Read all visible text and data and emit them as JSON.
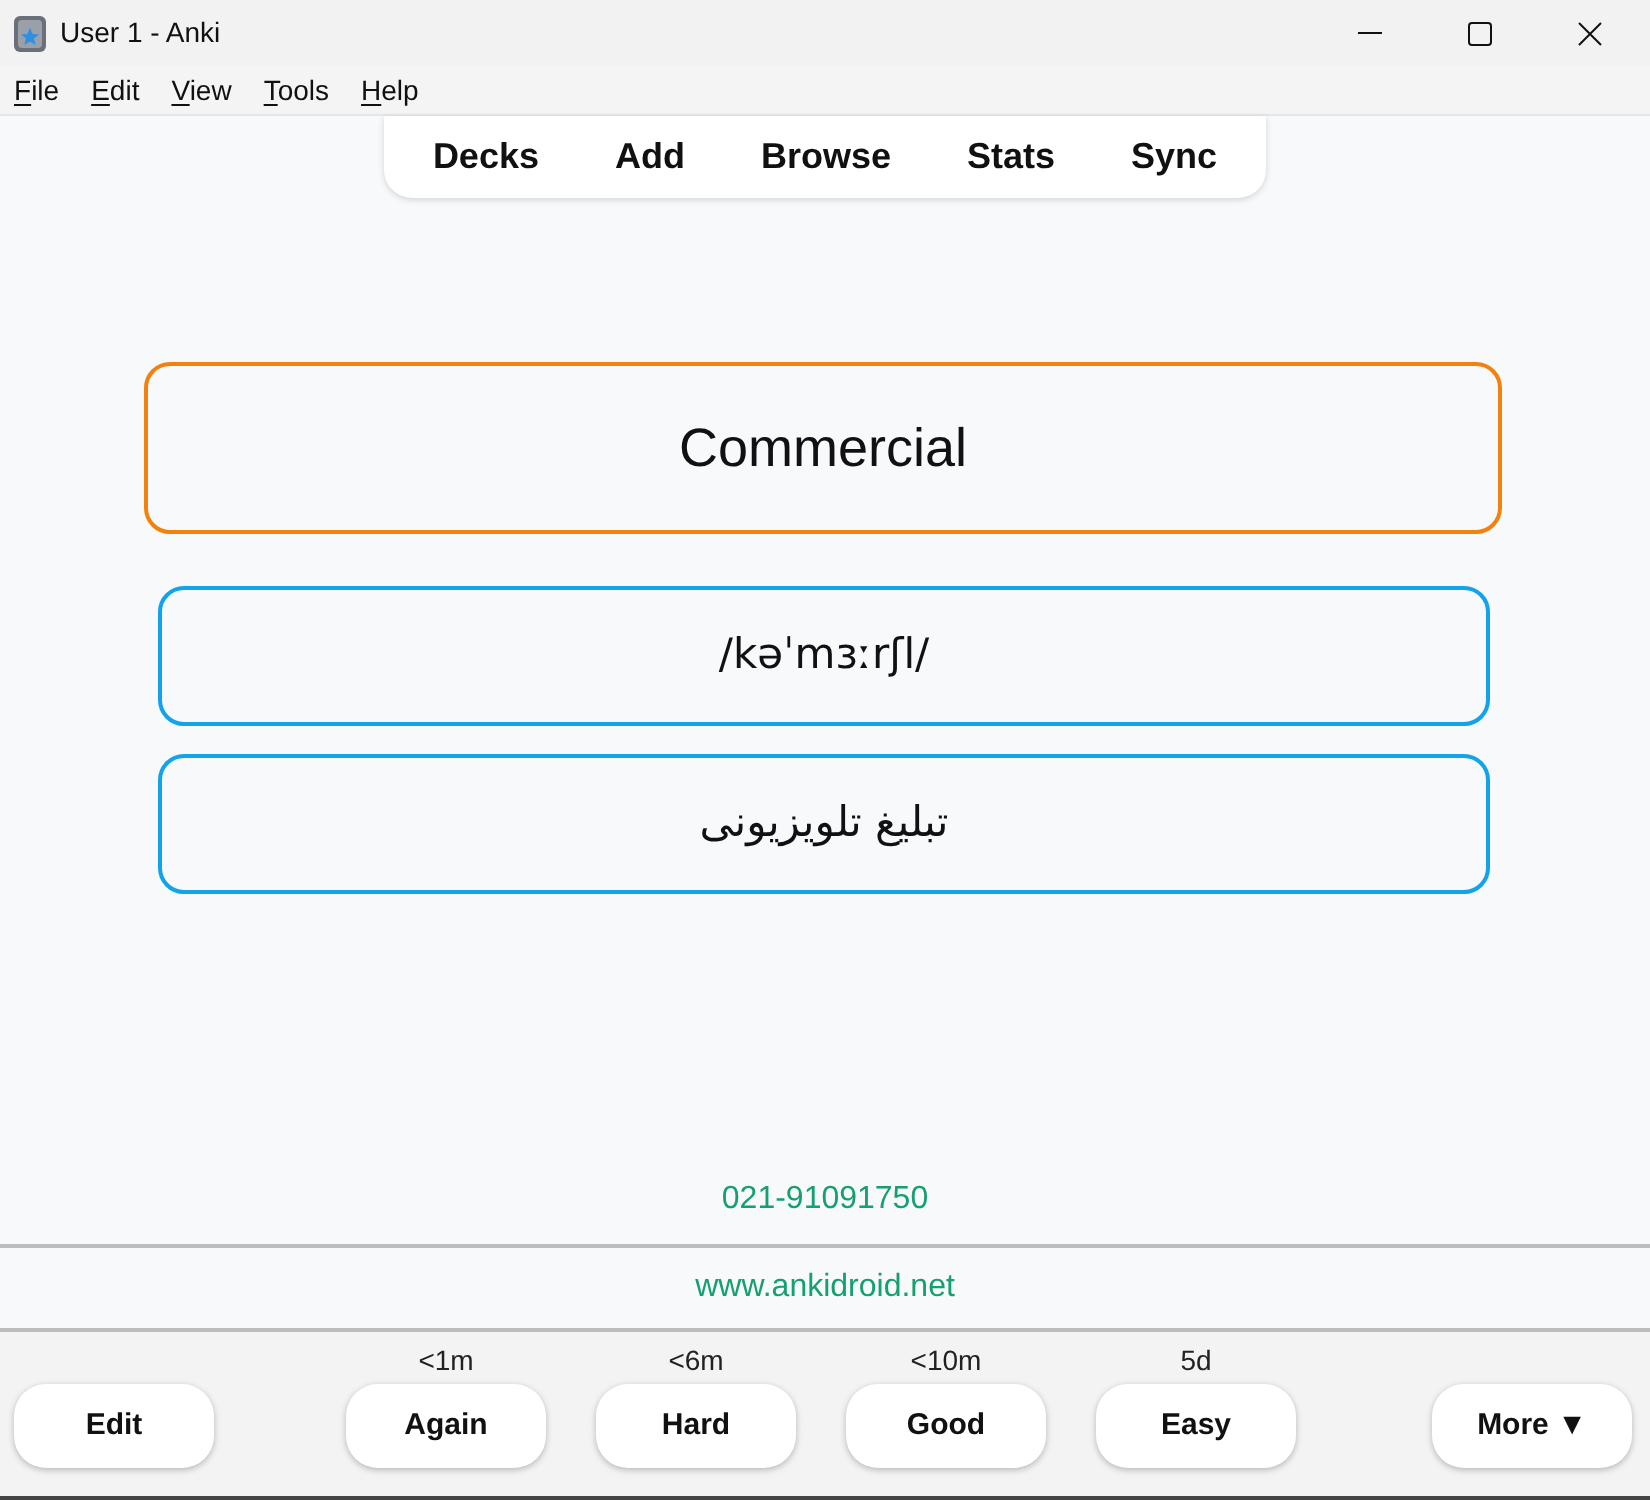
{
  "window": {
    "title": "User 1 - Anki"
  },
  "menu": [
    "File",
    "Edit",
    "View",
    "Tools",
    "Help"
  ],
  "toolbar": [
    "Decks",
    "Add",
    "Browse",
    "Stats",
    "Sync"
  ],
  "card": {
    "front": "Commercial",
    "fields": [
      "/kəˈmɜːrʃl/",
      "تبلیغ تلویزیونی"
    ],
    "phone": "021-91091750",
    "website": "www.ankidroid.net"
  },
  "bottom_bar": {
    "edit": "Edit",
    "answers": [
      {
        "label": "Again",
        "interval": "<1m"
      },
      {
        "label": "Hard",
        "interval": "<6m"
      },
      {
        "label": "Good",
        "interval": "<10m"
      },
      {
        "label": "Easy",
        "interval": "5d"
      }
    ],
    "more": "More ▼"
  }
}
